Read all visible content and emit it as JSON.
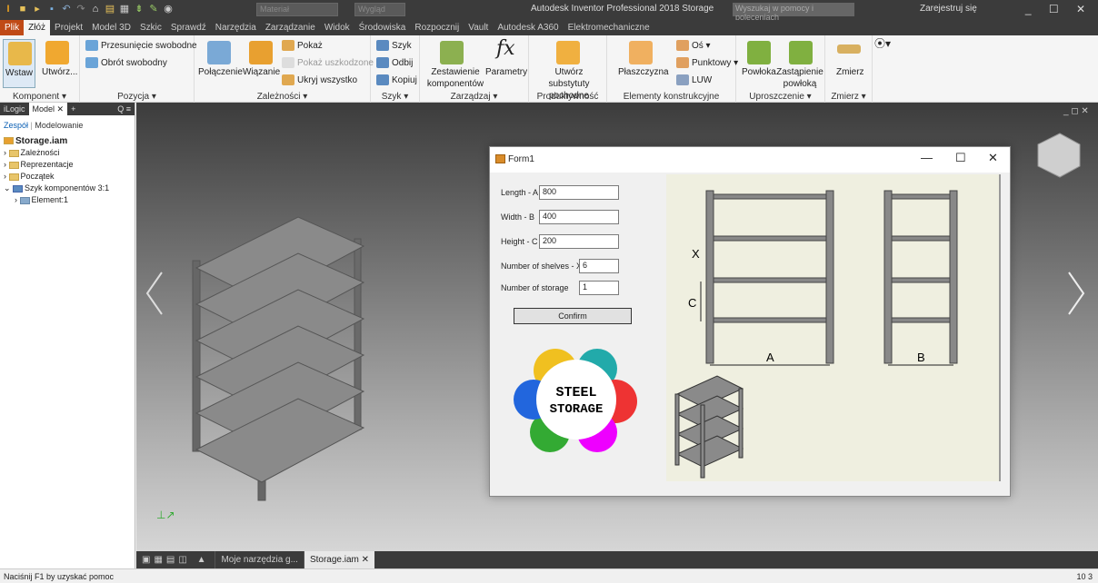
{
  "qat": {
    "material": "Materiał",
    "appearance": "Wygląd",
    "title": "Autodesk Inventor Professional 2018   Storage",
    "search": "Wyszukaj w pomocy i poleceniach",
    "signin": "Zarejestruj się",
    "win": "_ ☐ ✕"
  },
  "tabs": [
    "Plik",
    "Złóż",
    "Projekt",
    "Model 3D",
    "Szkic",
    "Sprawdź",
    "Narzędzia",
    "Zarządzanie",
    "Widok",
    "Środowiska",
    "Rozpocznij",
    "Vault",
    "Autodesk A360",
    "Elektromechaniczne"
  ],
  "ribbon": {
    "wstaw": "Wstaw",
    "utworz": "Utwórz...",
    "komponent": "Komponent ▾",
    "przesuniecie": "Przesunięcie swobodne",
    "obrot": "Obrót swobodny",
    "pozycja": "Pozycja ▾",
    "polaczenie": "Połączenie",
    "wiazanie": "Wiązanie",
    "pokaz": "Pokaż",
    "pokaz_uszk": "Pokaż uszkodzone",
    "ukryj": "Ukryj wszystko",
    "zaleznosci": "Zależności ▾",
    "szyk": "Szyk",
    "odbij": "Odbij",
    "kopiuj": "Kopiuj",
    "szyk_panel": "Szyk ▾",
    "zestawienie": "Zestawienie komponentów",
    "parametry": "Parametry",
    "zarzadzaj": "Zarządzaj ▾",
    "utworz_sub": "Utwórz substytuty pochodne",
    "produktywnosc": "Produktywność",
    "plaszczyzna": "Płaszczyzna",
    "os": "Oś ▾",
    "punktowy": "Punktowy ▾",
    "luw": "LUW",
    "elementy": "Elementy konstrukcyjne",
    "powloka": "Powłoka",
    "zastapienie": "Zastąpienie powłoką",
    "uproszczenie": "Uproszczenie ▾",
    "zmierz": "Zmierz",
    "zmierz_panel": "Zmierz ▾"
  },
  "browser": {
    "tabs": [
      "iLogic",
      "Model ✕",
      "+",
      "Q ≡"
    ],
    "sub1": "Zespół",
    "sub2": "Modelowanie",
    "items": [
      "Storage.iam",
      "Zależności",
      "Reprezentacje",
      "Początek",
      "Szyk komponentów 3:1",
      "Element:1"
    ]
  },
  "viewtabs": [
    "Moje narzędzia g...",
    "Storage.iam ✕"
  ],
  "status": {
    "left": "Naciśnij F1 by uzyskać pomoc",
    "right": "10   3"
  },
  "form": {
    "title": "Form1",
    "fields": [
      {
        "label": "Length - A",
        "value": "800"
      },
      {
        "label": "Width - B",
        "value": "400"
      },
      {
        "label": "Height - C",
        "value": "200"
      },
      {
        "label": "Number of shelves - X",
        "value": "6"
      },
      {
        "label": "Number of storage",
        "value": "1"
      }
    ],
    "confirm": "Confirm",
    "logo1": "STEEL",
    "logo2": "STORAGE",
    "dim": {
      "x": "X",
      "c": "C",
      "a": "A",
      "b": "B"
    }
  }
}
